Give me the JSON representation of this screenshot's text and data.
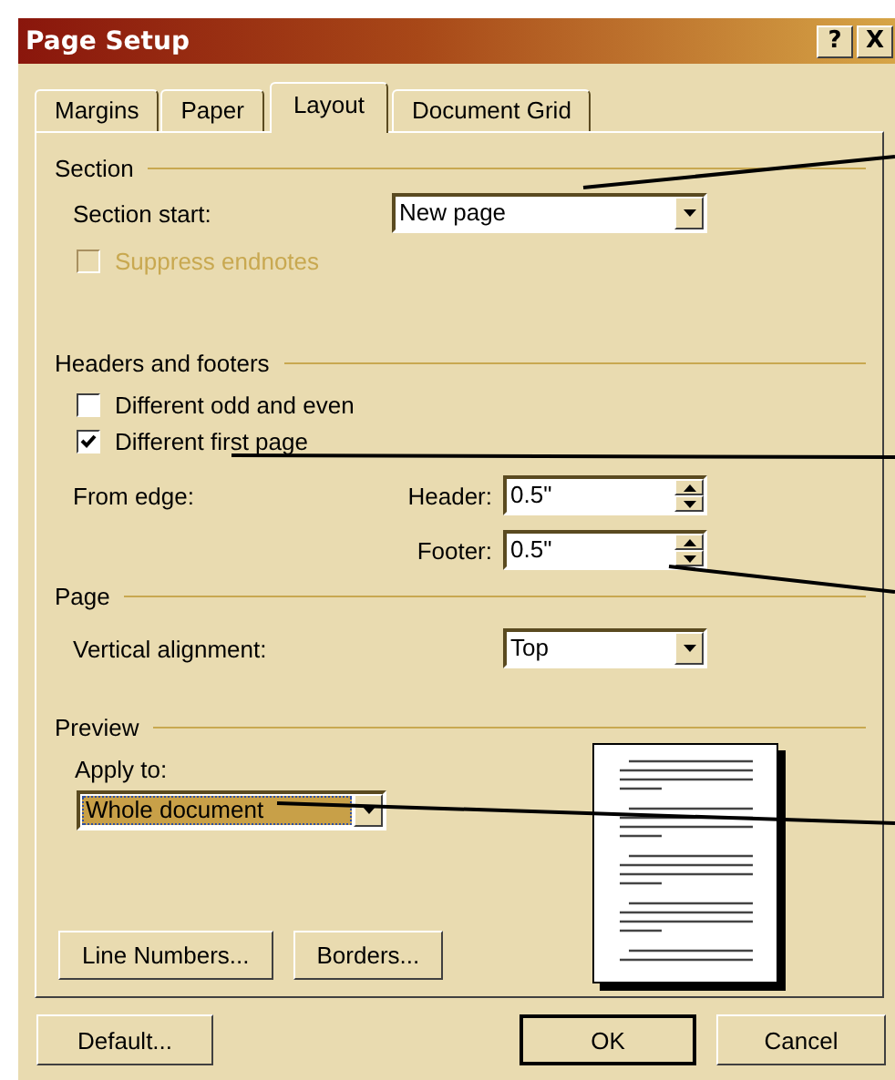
{
  "window": {
    "title": "Page Setup",
    "buttons": [
      "?",
      "X"
    ]
  },
  "tabs": [
    {
      "label": "Margins",
      "selected": false
    },
    {
      "label": "Paper",
      "selected": false
    },
    {
      "label": "Layout",
      "selected": true
    },
    {
      "label": "Document Grid",
      "selected": false
    }
  ],
  "groups": [
    {
      "title": "Section",
      "rows": [
        {
          "kind": "dropdown",
          "label": "Section start:",
          "value": "New page"
        },
        {
          "kind": "checkbox",
          "label": "Suppress endnotes",
          "checked": false,
          "disabled": true
        }
      ]
    },
    {
      "title": "Headers and footers",
      "rows": [
        {
          "kind": "checkbox",
          "label": "Different odd and even",
          "checked": false,
          "disabled": false
        },
        {
          "kind": "checkbox",
          "label": "Different first page",
          "checked": true,
          "disabled": false
        },
        {
          "kind": "spinner",
          "group_label": "From edge:",
          "label": "Header:",
          "value": "0.5\""
        },
        {
          "kind": "spinner",
          "label": "Footer:",
          "value": "0.5\""
        }
      ]
    },
    {
      "title": "Page",
      "rows": [
        {
          "kind": "dropdown",
          "label": "Vertical alignment:",
          "value": "Top"
        }
      ]
    }
  ],
  "preview": {
    "title": "Preview",
    "apply_label": "Apply to:",
    "apply_value": "Whole document",
    "selected": true,
    "buttons": [
      "Line Numbers...",
      "Borders..."
    ]
  },
  "dialog_buttons": [
    "Default...",
    "OK",
    "Cancel"
  ]
}
